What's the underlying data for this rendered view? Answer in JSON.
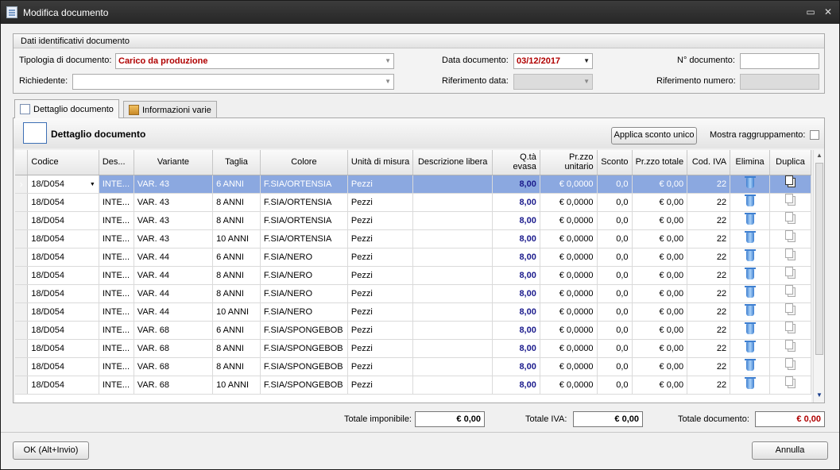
{
  "window": {
    "title": "Modifica documento"
  },
  "group": {
    "title": "Dati identificativi documento",
    "tipologia_label": "Tipologia di documento:",
    "tipologia_value": "Carico da produzione",
    "richiedente_label": "Richiedente:",
    "richiedente_value": "",
    "data_label": "Data documento:",
    "data_value": "03/12/2017",
    "rif_data_label": "Riferimento data:",
    "rif_data_value": "",
    "num_label": "N° documento:",
    "num_value": "",
    "rif_num_label": "Riferimento numero:",
    "rif_num_value": ""
  },
  "tabs": [
    {
      "label": "Dettaglio documento",
      "icon": "list-icon",
      "active": true
    },
    {
      "label": "Informazioni varie",
      "icon": "box-icon",
      "active": false
    }
  ],
  "panel": {
    "title": "Dettaglio documento",
    "apply_discount_label": "Applica sconto unico",
    "show_grouping_label": "Mostra raggruppamento:",
    "show_grouping_checked": false
  },
  "grid": {
    "columns": [
      "Codice",
      "Des...",
      "Variante",
      "Taglia",
      "Colore",
      "Unità di misura",
      "Descrizione libera",
      "Q.tà evasa",
      "Pr.zzo unitario",
      "Sconto",
      "Pr.zzo totale",
      "Cod. IVA",
      "Elimina",
      "Duplica"
    ],
    "rows": [
      {
        "codice": "18/D054",
        "des": "INTE...",
        "variante": "VAR. 43",
        "taglia": "6 ANNI",
        "colore": "F.SIA/ORTENSIA",
        "um": "Pezzi",
        "desc": "",
        "qty": "8,00",
        "prezzo": "€ 0,0000",
        "sconto": "0,0",
        "totale": "€ 0,00",
        "iva": "22"
      },
      {
        "codice": "18/D054",
        "des": "INTE...",
        "variante": "VAR. 43",
        "taglia": "8 ANNI",
        "colore": "F.SIA/ORTENSIA",
        "um": "Pezzi",
        "desc": "",
        "qty": "8,00",
        "prezzo": "€ 0,0000",
        "sconto": "0,0",
        "totale": "€ 0,00",
        "iva": "22"
      },
      {
        "codice": "18/D054",
        "des": "INTE...",
        "variante": "VAR. 43",
        "taglia": "8 ANNI",
        "colore": "F.SIA/ORTENSIA",
        "um": "Pezzi",
        "desc": "",
        "qty": "8,00",
        "prezzo": "€ 0,0000",
        "sconto": "0,0",
        "totale": "€ 0,00",
        "iva": "22"
      },
      {
        "codice": "18/D054",
        "des": "INTE...",
        "variante": "VAR. 43",
        "taglia": "10 ANNI",
        "colore": "F.SIA/ORTENSIA",
        "um": "Pezzi",
        "desc": "",
        "qty": "8,00",
        "prezzo": "€ 0,0000",
        "sconto": "0,0",
        "totale": "€ 0,00",
        "iva": "22"
      },
      {
        "codice": "18/D054",
        "des": "INTE...",
        "variante": "VAR. 44",
        "taglia": "6 ANNI",
        "colore": "F.SIA/NERO",
        "um": "Pezzi",
        "desc": "",
        "qty": "8,00",
        "prezzo": "€ 0,0000",
        "sconto": "0,0",
        "totale": "€ 0,00",
        "iva": "22"
      },
      {
        "codice": "18/D054",
        "des": "INTE...",
        "variante": "VAR. 44",
        "taglia": "8 ANNI",
        "colore": "F.SIA/NERO",
        "um": "Pezzi",
        "desc": "",
        "qty": "8,00",
        "prezzo": "€ 0,0000",
        "sconto": "0,0",
        "totale": "€ 0,00",
        "iva": "22"
      },
      {
        "codice": "18/D054",
        "des": "INTE...",
        "variante": "VAR. 44",
        "taglia": "8 ANNI",
        "colore": "F.SIA/NERO",
        "um": "Pezzi",
        "desc": "",
        "qty": "8,00",
        "prezzo": "€ 0,0000",
        "sconto": "0,0",
        "totale": "€ 0,00",
        "iva": "22"
      },
      {
        "codice": "18/D054",
        "des": "INTE...",
        "variante": "VAR. 44",
        "taglia": "10 ANNI",
        "colore": "F.SIA/NERO",
        "um": "Pezzi",
        "desc": "",
        "qty": "8,00",
        "prezzo": "€ 0,0000",
        "sconto": "0,0",
        "totale": "€ 0,00",
        "iva": "22"
      },
      {
        "codice": "18/D054",
        "des": "INTE...",
        "variante": "VAR. 68",
        "taglia": "6 ANNI",
        "colore": "F.SIA/SPONGEBOB",
        "um": "Pezzi",
        "desc": "",
        "qty": "8,00",
        "prezzo": "€ 0,0000",
        "sconto": "0,0",
        "totale": "€ 0,00",
        "iva": "22"
      },
      {
        "codice": "18/D054",
        "des": "INTE...",
        "variante": "VAR. 68",
        "taglia": "8 ANNI",
        "colore": "F.SIA/SPONGEBOB",
        "um": "Pezzi",
        "desc": "",
        "qty": "8,00",
        "prezzo": "€ 0,0000",
        "sconto": "0,0",
        "totale": "€ 0,00",
        "iva": "22"
      },
      {
        "codice": "18/D054",
        "des": "INTE...",
        "variante": "VAR. 68",
        "taglia": "8 ANNI",
        "colore": "F.SIA/SPONGEBOB",
        "um": "Pezzi",
        "desc": "",
        "qty": "8,00",
        "prezzo": "€ 0,0000",
        "sconto": "0,0",
        "totale": "€ 0,00",
        "iva": "22"
      },
      {
        "codice": "18/D054",
        "des": "INTE...",
        "variante": "VAR. 68",
        "taglia": "10 ANNI",
        "colore": "F.SIA/SPONGEBOB",
        "um": "Pezzi",
        "desc": "",
        "qty": "8,00",
        "prezzo": "€ 0,0000",
        "sconto": "0,0",
        "totale": "€ 0,00",
        "iva": "22"
      }
    ],
    "selected_row": 0
  },
  "totals": {
    "imponibile_label": "Totale imponibile:",
    "imponibile_value": "€ 0,00",
    "iva_label": "Totale IVA:",
    "iva_value": "€ 0,00",
    "documento_label": "Totale documento:",
    "documento_value": "€ 0,00"
  },
  "footer": {
    "ok_label": "OK (Alt+Invio)",
    "cancel_label": "Annulla"
  },
  "colors": {
    "selection": "#8ba8e0",
    "quantity": "#1a1a8c",
    "required": "#b00000"
  }
}
